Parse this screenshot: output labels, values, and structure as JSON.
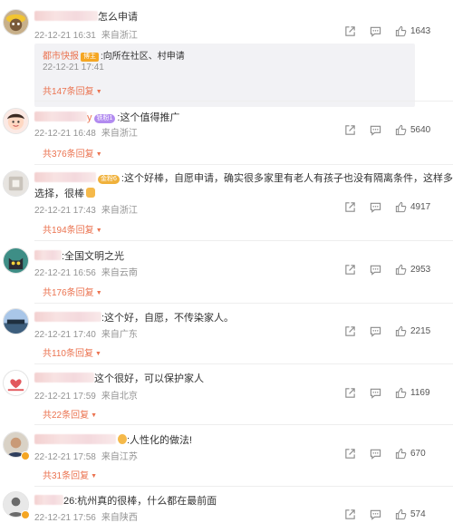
{
  "colors": {
    "accent": "#eb7350",
    "meta": "#939393",
    "badge_purple": "#b28bf0",
    "badge_gold": "#f0b13b"
  },
  "icons": {
    "share": "share-icon",
    "comment": "comment-icon",
    "like": "thumbs-up-icon"
  },
  "comments": [
    {
      "text": "怎么申请",
      "badge": "",
      "time": "22-12-21 16:31",
      "location": "来自浙江",
      "likes": "1643",
      "nested": {
        "author": "都市快报",
        "tag": "博主",
        "text": ":向所在社区、村申请",
        "time": "22-12-21 17:41",
        "replies": "共147条回复"
      },
      "replies": ""
    },
    {
      "text": ":这个值得推广",
      "badge": "铁粉1",
      "time": "22-12-21 16:48",
      "location": "来自浙江",
      "likes": "5640",
      "replies": "共376条回复"
    },
    {
      "text": ":这个好棒，自愿申请，确实很多家里有老人有孩子也没有隔离条件，这样多一个",
      "text2": "选择，很棒",
      "badge": "金粉6",
      "time": "22-12-21 17:43",
      "location": "来自浙江",
      "likes": "4917",
      "replies": "共194条回复"
    },
    {
      "text": ":全国文明之光",
      "badge": "",
      "time": "22-12-21 16:56",
      "location": "来自云南",
      "likes": "2953",
      "replies": "共176条回复"
    },
    {
      "text": ":这个好，自愿，不传染家人。",
      "badge": "",
      "time": "22-12-21 17:40",
      "location": "来自广东",
      "likes": "2215",
      "replies": "共110条回复"
    },
    {
      "text": "这个很好，可以保护家人",
      "badge": "",
      "time": "22-12-21 17:59",
      "location": "来自北京",
      "likes": "1169",
      "replies": "共22条回复"
    },
    {
      "text": ":人性化的做法!",
      "badge": "",
      "time": "22-12-21 17:58",
      "location": "来自江苏",
      "likes": "670",
      "replies": "共31条回复"
    },
    {
      "text": "26:杭州真的很棒，什么都在最前面",
      "badge": "",
      "time": "22-12-21 17:56",
      "location": "来自陕西",
      "likes": "574",
      "replies": ""
    }
  ]
}
